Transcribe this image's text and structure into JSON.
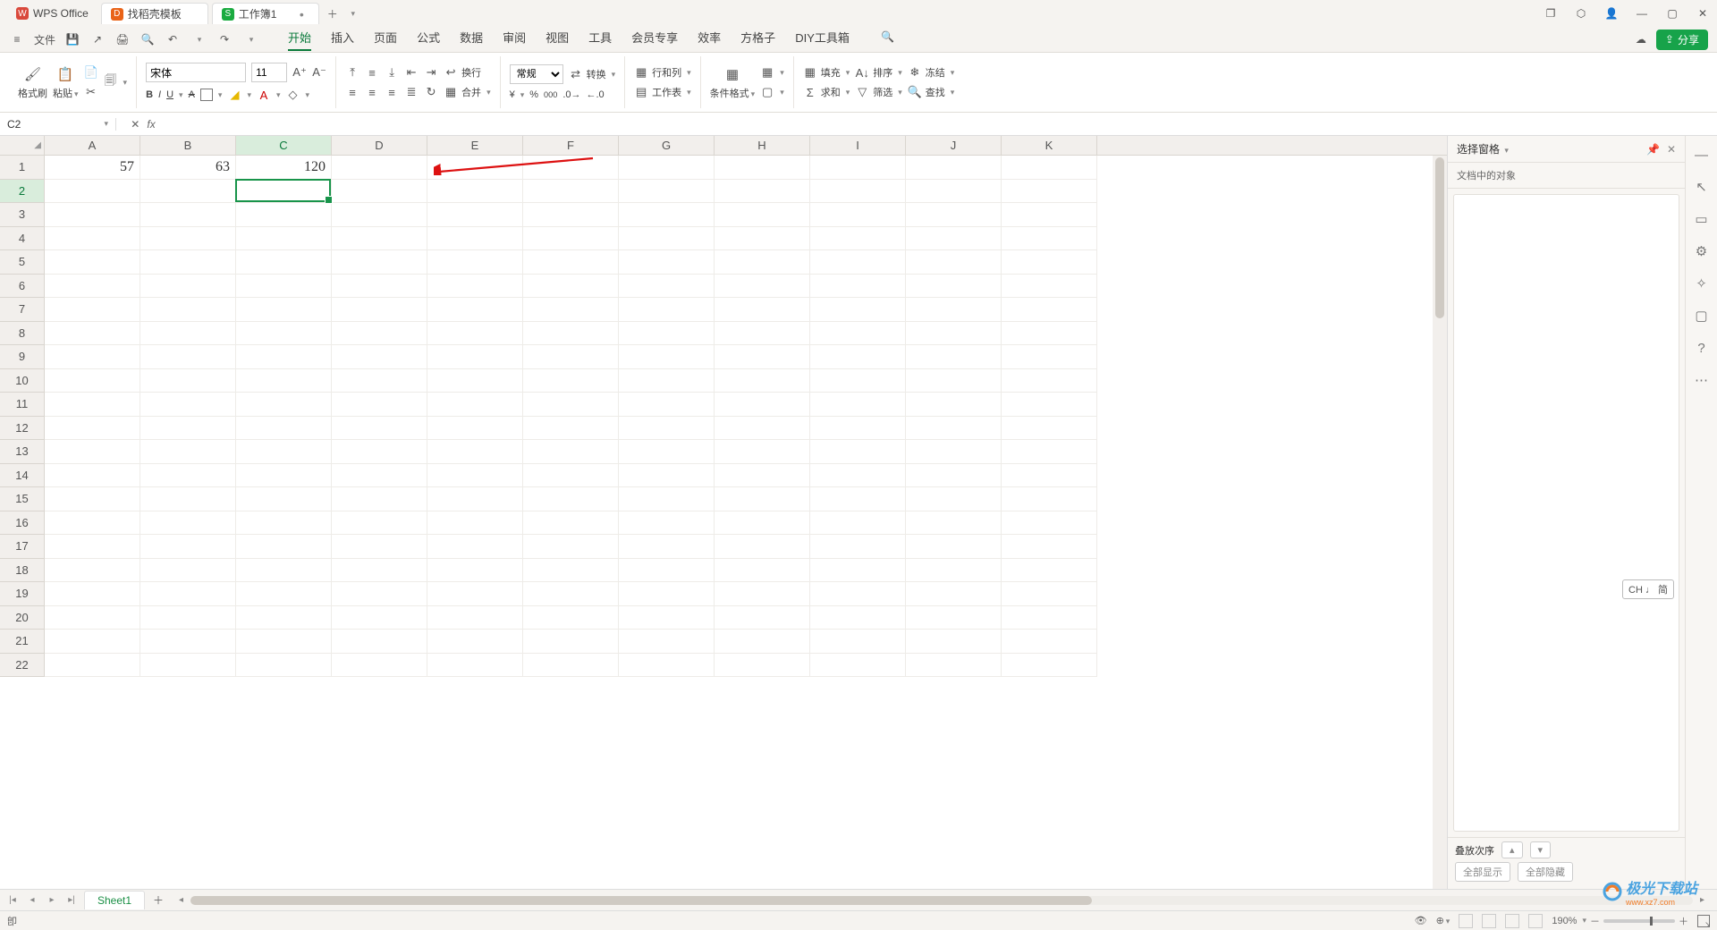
{
  "tabs": {
    "app": "WPS Office",
    "template": "找稻壳模板",
    "doc": "工作簿1"
  },
  "file_menu": "文件",
  "menus": [
    "开始",
    "插入",
    "页面",
    "公式",
    "数据",
    "审阅",
    "视图",
    "工具",
    "会员专享",
    "效率",
    "方格子",
    "DIY工具箱"
  ],
  "share": "分享",
  "ribbon": {
    "format_painter": "格式刷",
    "paste": "粘贴",
    "font_name": "宋体",
    "font_size": "11",
    "wrap": "换行",
    "number_format": "常规",
    "convert": "转换",
    "rowcol": "行和列",
    "worksheet": "工作表",
    "cond_format": "条件格式",
    "fill": "填充",
    "sort": "排序",
    "freeze": "冻结",
    "sum": "求和",
    "filter": "筛选",
    "find": "查找",
    "merge": "合并"
  },
  "name_box": "C2",
  "fx": "fx",
  "columns": [
    "A",
    "B",
    "C",
    "D",
    "E",
    "F",
    "G",
    "H",
    "I",
    "J",
    "K"
  ],
  "row_count": 22,
  "cells": {
    "A1": "57",
    "B1": "63",
    "C1": "120"
  },
  "active_cell": {
    "col": 2,
    "row": 1
  },
  "selected_col": 2,
  "selected_row": 1,
  "sheet": "Sheet1",
  "right_panel": {
    "title": "选择窗格",
    "sub": "文档中的对象",
    "stack": "叠放次序",
    "show_all": "全部显示",
    "hide_all": "全部隐藏"
  },
  "status": {
    "indicator": "卽",
    "zoom": "190%"
  },
  "ime": "CH ♩ 简",
  "watermark": {
    "main": "极光下载站",
    "sub": "www.xz7.com"
  }
}
